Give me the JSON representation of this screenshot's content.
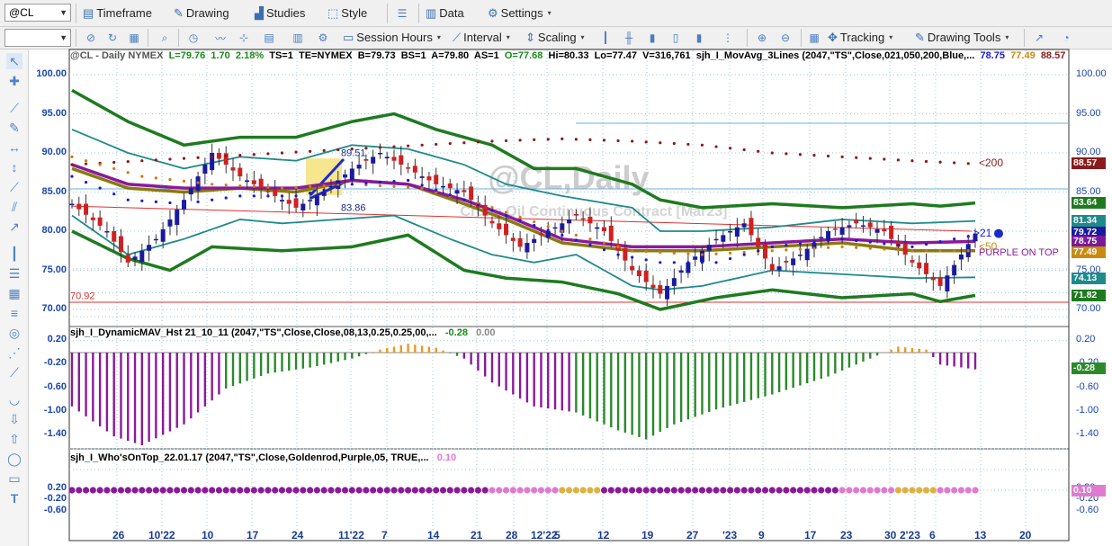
{
  "toolbar1": {
    "symbol_value": "@CL",
    "timeframe": "Timeframe",
    "drawing": "Drawing",
    "studies": "Studies",
    "style": "Style",
    "data": "Data",
    "settings": "Settings"
  },
  "toolbar2": {
    "session_hours": "Session Hours",
    "interval": "Interval",
    "scaling": "Scaling",
    "tracking": "Tracking",
    "drawing_tools": "Drawing Tools"
  },
  "chart": {
    "status": {
      "symbol": "@CL - Daily  NYMEX",
      "l": "L=79.76",
      "chg": "1.70",
      "pct": "2.18%",
      "ts": "TS=1",
      "te": "TE=NYMEX",
      "b": "B=79.73",
      "bs": "BS=1",
      "a": "A=79.80",
      "as": "AS=1",
      "o": "O=77.68",
      "hi": "Hi=80.33",
      "lo": "Lo=77.47",
      "v": "V=316,761",
      "study": "sjh_I_MovAvg_3Lines (2047,\"TS\",Close,021,050,200,Blue,...",
      "v1": "78.75",
      "v2": "77.49",
      "v3": "88.57"
    },
    "watermark_title": "@CL,Daily",
    "watermark_sub": "Crude Oil Continuous Contract [Mar23]",
    "annotations": {
      "top_label": "89.51",
      "bottom_label": "83.86",
      "ma200_label": "<200",
      "ma21_label": ">21",
      "ma50_label": "<50",
      "left_hline_label": "70.92",
      "purple_on_top": "PURPLE ON TOP"
    },
    "price_tags": [
      {
        "label": "88.57",
        "color": "#8b1a1a"
      },
      {
        "label": "83.64",
        "color": "#1f7a1f"
      },
      {
        "label": "81.34",
        "color": "#1f8a8a"
      },
      {
        "label": "79.72",
        "color": "#1a1aa0"
      },
      {
        "label": "78.75",
        "color": "#7a1a9a"
      },
      {
        "label": "77.49",
        "color": "#c88a10"
      },
      {
        "label": "74.13",
        "color": "#1f8a8a"
      },
      {
        "label": "71.82",
        "color": "#1f7a1f"
      }
    ],
    "price_axis": [
      "100.00",
      "95.00",
      "90.00",
      "85.00",
      "80.00",
      "75.00",
      "70.00"
    ],
    "x_axis": [
      "26",
      "10'22",
      "10",
      "17",
      "24",
      "11'22",
      "7",
      "14",
      "21",
      "28",
      "12'22",
      "5",
      "12",
      "19",
      "27",
      "'23",
      "9",
      "17",
      "23",
      "30",
      "2'23",
      "6",
      "13",
      "20"
    ]
  },
  "panel2": {
    "label": "sjh_I_DynamicMAV_Hst 21_10_11 (2047,\"TS\",Close,Close,08,13,0.25,0.25,00,...",
    "val1": "-0.28",
    "val2": "0.00",
    "axis": [
      "0.20",
      "-0.20",
      "-0.60",
      "-1.00",
      "-1.40"
    ],
    "tag": "-0.28"
  },
  "panel3": {
    "label": "sjh_I_Who'sOnTop_22.01.17 (2047,\"TS\",Close,Goldenrod,Purple,05, TRUE,...",
    "val": "0.10",
    "axis": [
      "0.20",
      "-0.20",
      "-0.60"
    ],
    "tag": "0.10"
  },
  "colors": {
    "ma200": "#8b1a1a",
    "ma21": "#1a1ad0",
    "ma50": "#d07a10",
    "bollinger_outer": "#1f7a1f",
    "bollinger_inner": "#1f8a8a",
    "up": "#1a1aa0",
    "down": "#d02020",
    "hist_purple": "#8a1a9a",
    "hist_green": "#2a8a2a",
    "hist_orange": "#e89a20",
    "dot_purple": "#8a1a9a",
    "dot_pink": "#e07ad0"
  },
  "icons": {
    "timeframe": "calendar-icon",
    "drawing": "pencil-icon",
    "studies": "chart-icon",
    "style": "style-icon",
    "data": "data-icon",
    "settings": "gear-icon"
  }
}
